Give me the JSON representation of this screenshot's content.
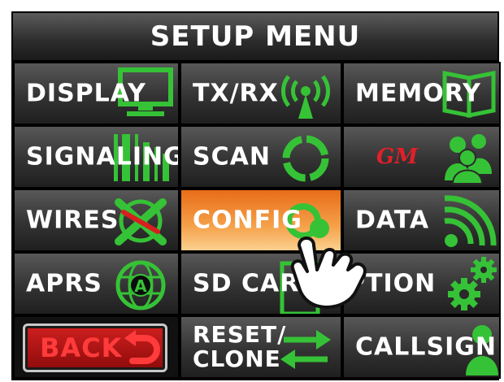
{
  "title": "SETUP MENU",
  "menu": {
    "display": "DISPLAY",
    "txrx": "TX/RX",
    "memory": "MEMORY",
    "signaling": "SIGNALING",
    "scan": "SCAN",
    "gm": "GM",
    "wires": "WIRES",
    "config": "CONFIG",
    "data": "DATA",
    "aprs": "APRS",
    "sdcard": "SD CARD",
    "option": "PTION",
    "back": "BACK",
    "reset_line1": "RESET/",
    "reset_line2": "CLONE",
    "callsign": "CALLSIGN"
  },
  "colors": {
    "icon_green": "#36c236",
    "active_orange": "#f08a2c",
    "back_red": "#ff3b3b"
  },
  "icons": [
    "monitor-icon",
    "antenna-icon",
    "book-icon",
    "barcode-icon",
    "scan-circle-icon",
    "gm-icon",
    "group-icon",
    "wires-icon",
    "config-icon",
    "wifi-icon",
    "globe-a-icon",
    "sd-card-icon",
    "gears-icon",
    "return-arrow-icon",
    "swap-arrows-icon",
    "person-icon",
    "pointing-hand-icon"
  ]
}
